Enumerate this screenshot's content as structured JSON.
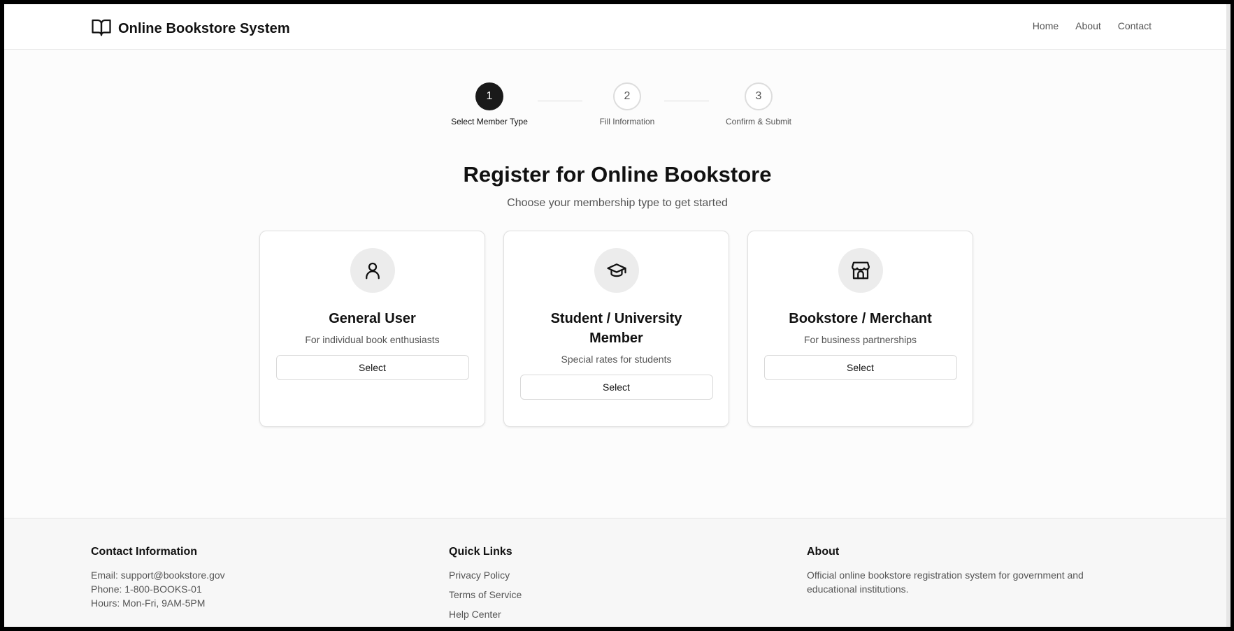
{
  "header": {
    "brand_title": "Online Bookstore System",
    "brand_icon": "book-open-icon",
    "nav": [
      "Home",
      "About",
      "Contact"
    ]
  },
  "stepper": {
    "current": 1,
    "steps": [
      {
        "number": "1",
        "label": "Select Member Type"
      },
      {
        "number": "2",
        "label": "Fill Information"
      },
      {
        "number": "3",
        "label": "Confirm & Submit"
      }
    ]
  },
  "main": {
    "title": "Register for Online Bookstore",
    "subtitle": "Choose your membership type to get started",
    "cards": [
      {
        "icon": "user-icon",
        "title": "General User",
        "description": "For individual book enthusiasts",
        "button": "Select"
      },
      {
        "icon": "graduation-cap-icon",
        "title": "Student / University Member",
        "description": "Special rates for students",
        "button": "Select"
      },
      {
        "icon": "store-icon",
        "title": "Bookstore / Merchant",
        "description": "For business partnerships",
        "button": "Select"
      }
    ]
  },
  "footer": {
    "contact": {
      "heading": "Contact Information",
      "email": "Email: support@bookstore.gov",
      "phone": "Phone: 1-800-BOOKS-01",
      "hours": "Hours: Mon-Fri, 9AM-5PM"
    },
    "links": {
      "heading": "Quick Links",
      "items": [
        "Privacy Policy",
        "Terms of Service",
        "Help Center"
      ]
    },
    "about": {
      "heading": "About",
      "text": "Official online bookstore registration system for government and educational institutions."
    }
  },
  "colors": {
    "active_step": "#1a1a1a",
    "page_bg": "#fcfcfc",
    "footer_bg": "#f7f7f7",
    "icon_circle": "#ececec"
  }
}
